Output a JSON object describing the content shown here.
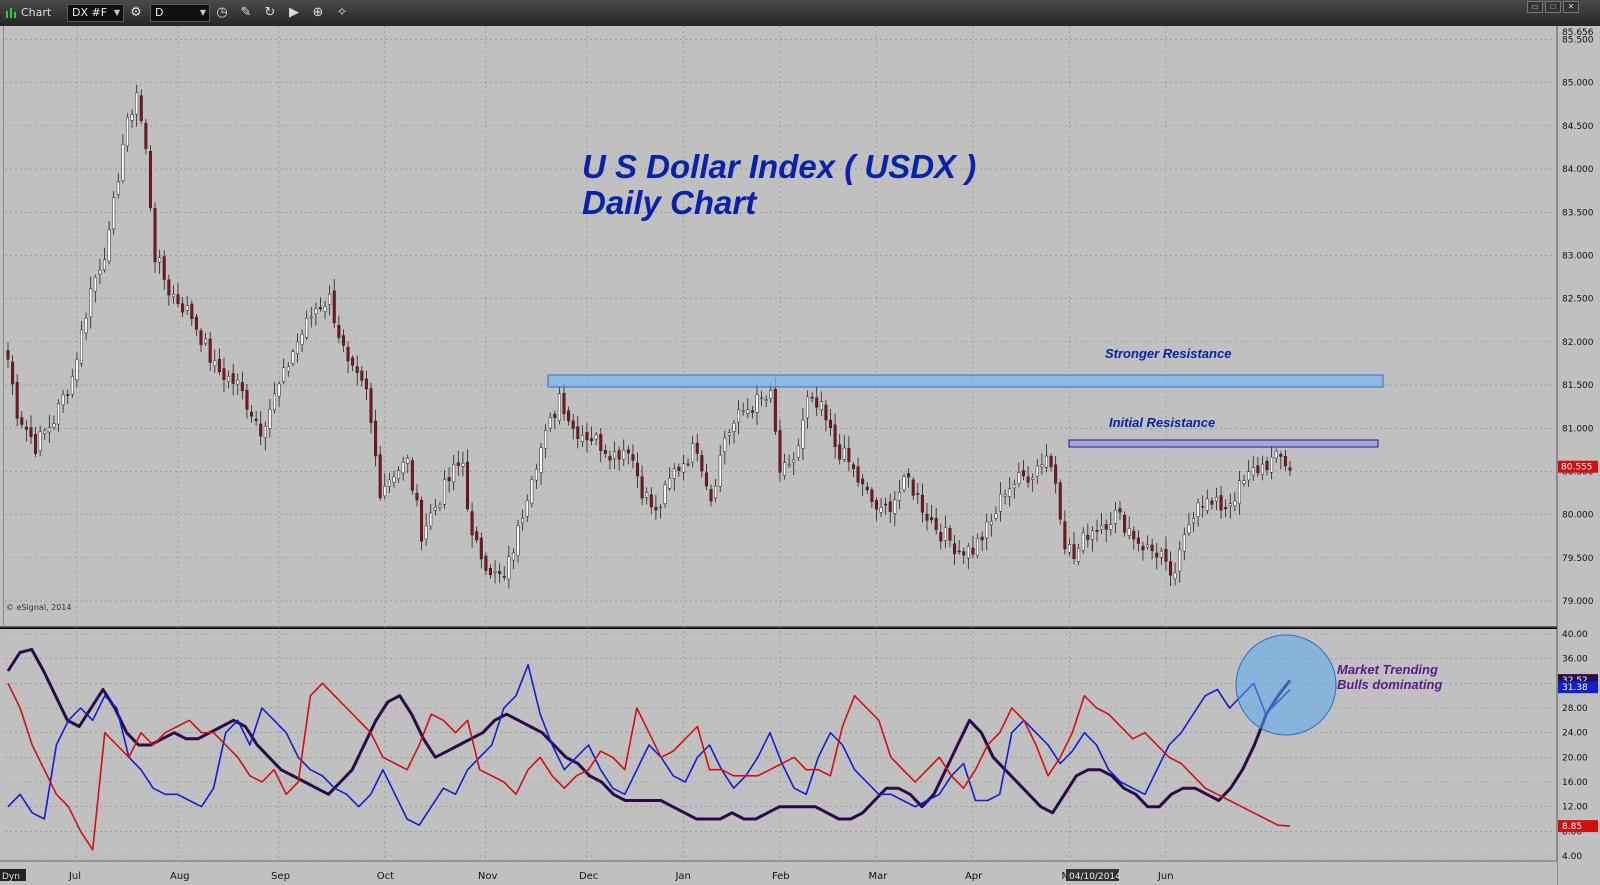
{
  "window": {
    "title": "Chart",
    "symbol": "DX #F",
    "interval": "D",
    "toolbar_icons": [
      "settings-icon",
      "clock-icon",
      "pencil-icon",
      "refresh-icon",
      "play-icon",
      "zoom-icon",
      "wand-icon"
    ]
  },
  "annotations": {
    "title_line1": "U S Dollar Index  ( USDX )",
    "title_line2": "Daily Chart",
    "stronger_resistance": "Stronger Resistance",
    "initial_resistance": "Initial Resistance",
    "trend_line1": "Market Trending",
    "trend_line2": "Bulls dominating",
    "copyright": "© eSignal, 2014",
    "cursor_date": "04/10/2014",
    "dyn_label": "Dyn"
  },
  "colors": {
    "panel_bg": "#c0c0c0",
    "up_candle": "#ffffff",
    "down_candle": "#8b1010",
    "title_blue": "#0a22a8",
    "resistance_fill": "#7eb8ec",
    "adx_line": "#2a0a48",
    "plus_di": "#1020d0",
    "minus_di": "#d01010",
    "callout_purple": "#5a1a8a"
  },
  "chart_data": [
    {
      "type": "candlestick",
      "title": "U S Dollar Index  ( USDX ) Daily Chart",
      "symbol": "DX #F",
      "x_ticks": [
        "Jul",
        "Aug",
        "Sep",
        "Oct",
        "Nov",
        "Dec",
        "Jan",
        "Feb",
        "Mar",
        "Apr",
        "May",
        "Jun"
      ],
      "ylim": [
        78.7,
        85.656
      ],
      "y_ticks": [
        "79.000",
        "79.500",
        "80.000",
        "80.500",
        "81.000",
        "81.500",
        "82.000",
        "82.500",
        "83.000",
        "83.500",
        "84.000",
        "84.500",
        "85.000",
        "85.500"
      ],
      "top_price": "85.656",
      "last_price": "80.555",
      "close_anchors": [
        [
          0,
          81.8
        ],
        [
          2,
          81.2
        ],
        [
          6,
          80.8
        ],
        [
          10,
          81.1
        ],
        [
          14,
          81.6
        ],
        [
          18,
          82.6
        ],
        [
          22,
          83.2
        ],
        [
          25,
          84.3
        ],
        [
          28,
          84.9
        ],
        [
          30,
          84.2
        ],
        [
          32,
          83.0
        ],
        [
          35,
          82.6
        ],
        [
          40,
          82.3
        ],
        [
          45,
          81.7
        ],
        [
          50,
          81.5
        ],
        [
          55,
          81.0
        ],
        [
          60,
          81.6
        ],
        [
          62,
          81.9
        ],
        [
          67,
          82.4
        ],
        [
          70,
          82.5
        ],
        [
          74,
          81.7
        ],
        [
          78,
          81.4
        ],
        [
          81,
          80.3
        ],
        [
          84,
          80.5
        ],
        [
          87,
          80.6
        ],
        [
          90,
          79.8
        ],
        [
          93,
          80.1
        ],
        [
          97,
          80.5
        ],
        [
          99,
          80.6
        ],
        [
          101,
          79.7
        ],
        [
          106,
          79.3
        ],
        [
          108,
          79.25
        ],
        [
          111,
          79.8
        ],
        [
          114,
          80.5
        ],
        [
          117,
          80.9
        ],
        [
          119,
          81.2
        ],
        [
          120,
          81.4
        ],
        [
          123,
          81.0
        ],
        [
          127,
          80.9
        ],
        [
          132,
          80.7
        ],
        [
          135,
          80.8
        ],
        [
          138,
          80.3
        ],
        [
          141,
          80.0
        ],
        [
          145,
          80.5
        ],
        [
          150,
          80.8
        ],
        [
          153,
          80.2
        ],
        [
          156,
          80.9
        ],
        [
          160,
          81.2
        ],
        [
          163,
          81.3
        ],
        [
          166,
          81.35
        ],
        [
          168,
          80.5
        ],
        [
          170,
          80.5
        ],
        [
          172,
          80.8
        ],
        [
          174,
          81.3
        ],
        [
          177,
          81.2
        ],
        [
          180,
          80.8
        ],
        [
          183,
          80.6
        ],
        [
          186,
          80.3
        ],
        [
          190,
          80.0
        ],
        [
          193,
          80.2
        ],
        [
          196,
          80.4
        ],
        [
          198,
          80.2
        ],
        [
          200,
          80.0
        ],
        [
          203,
          79.8
        ],
        [
          207,
          79.6
        ],
        [
          210,
          79.6
        ],
        [
          214,
          79.9
        ],
        [
          217,
          80.3
        ],
        [
          220,
          80.4
        ],
        [
          223,
          80.5
        ],
        [
          226,
          80.7
        ],
        [
          228,
          80.4
        ],
        [
          230,
          79.7
        ],
        [
          232,
          79.5
        ],
        [
          235,
          79.8
        ],
        [
          238,
          79.9
        ],
        [
          241,
          80.0
        ],
        [
          243,
          79.9
        ],
        [
          246,
          79.7
        ],
        [
          248,
          79.6
        ],
        [
          251,
          79.55
        ],
        [
          253,
          79.2
        ],
        [
          255,
          79.5
        ],
        [
          257,
          79.9
        ],
        [
          259,
          80.2
        ],
        [
          262,
          80.1
        ],
        [
          265,
          80.1
        ],
        [
          268,
          80.3
        ],
        [
          271,
          80.5
        ],
        [
          274,
          80.6
        ],
        [
          277,
          80.65
        ],
        [
          279,
          80.55
        ]
      ],
      "annotations": [
        {
          "label": "Stronger Resistance",
          "price_low": 81.45,
          "price_high": 81.58
        },
        {
          "label": "Initial Resistance",
          "price_low": 80.7,
          "price_high": 80.78
        }
      ],
      "grid": true
    },
    {
      "type": "line",
      "name": "ADX / DMI",
      "ylim": [
        4,
        40
      ],
      "y_ticks": [
        "4.00",
        "8.00",
        "12.00",
        "16.00",
        "20.00",
        "24.00",
        "28.00",
        "32.00",
        "36.00",
        "40.00"
      ],
      "last_values": {
        "adx": "32.52",
        "plus_di": "31.38",
        "minus_di": "8.85"
      },
      "series": [
        {
          "key": "adx",
          "values": [
            34,
            37,
            37.5,
            34,
            30,
            26,
            25,
            28,
            31,
            28,
            24,
            22,
            22,
            23,
            24,
            23,
            23,
            24,
            25,
            26,
            25,
            22,
            20,
            18,
            17,
            16,
            15,
            14,
            16,
            18,
            22,
            26,
            29,
            30,
            27,
            23,
            20,
            21,
            22,
            23,
            24,
            26,
            27,
            26,
            25,
            24,
            22,
            20,
            19,
            17,
            16,
            14,
            13,
            13,
            13,
            13,
            12,
            11,
            10,
            10,
            10,
            11,
            10,
            10,
            11,
            12,
            12,
            12,
            12,
            11,
            10,
            10,
            11,
            13,
            15,
            15,
            14,
            12,
            14,
            18,
            22,
            26,
            24,
            20,
            18,
            16,
            14,
            12,
            11,
            14,
            17,
            18,
            18,
            17,
            15,
            14,
            12,
            12,
            14,
            15,
            15,
            14,
            13,
            15,
            18,
            22,
            27,
            30,
            32.5
          ]
        },
        {
          "key": "plus_di",
          "values": [
            12,
            14,
            11,
            10,
            22,
            26,
            28,
            26,
            30,
            28,
            20,
            18,
            15,
            14,
            14,
            13,
            12,
            15,
            24,
            26,
            22,
            28,
            26,
            24,
            20,
            18,
            17,
            15,
            14,
            12,
            14,
            18,
            14,
            10,
            9,
            12,
            15,
            14,
            18,
            20,
            22,
            28,
            30,
            35,
            27,
            22,
            18,
            20,
            22,
            18,
            15,
            14,
            18,
            22,
            20,
            17,
            16,
            20,
            22,
            18,
            15,
            17,
            20,
            24,
            19,
            15,
            14,
            20,
            24,
            22,
            18,
            16,
            14,
            14,
            13,
            12,
            13,
            14,
            17,
            19,
            13,
            13,
            14,
            24,
            26,
            24,
            22,
            19,
            21,
            24,
            22,
            18,
            16,
            15,
            14,
            18,
            22,
            24,
            27,
            30,
            31,
            28,
            30,
            32,
            27,
            29,
            31
          ]
        },
        {
          "key": "minus_di",
          "values": [
            32,
            28,
            22,
            18,
            14,
            12,
            8,
            5,
            24,
            22,
            20,
            24,
            22,
            24,
            25,
            26,
            24,
            24,
            22,
            20,
            17,
            16,
            18,
            14,
            16,
            30,
            32,
            30,
            28,
            26,
            24,
            20,
            19,
            18,
            22,
            27,
            26,
            24,
            26,
            18,
            17,
            16,
            14,
            18,
            20,
            17,
            15,
            17,
            18,
            21,
            20,
            18,
            28,
            24,
            20,
            21,
            23,
            25,
            18,
            18,
            17,
            17,
            17,
            18,
            19,
            20,
            18,
            18,
            17,
            25,
            30,
            28,
            26,
            20,
            18,
            16,
            18,
            20,
            17,
            15,
            18,
            22,
            24,
            28,
            26,
            22,
            17,
            20,
            24,
            30,
            28,
            27,
            25,
            23,
            24,
            22,
            20,
            19,
            17,
            15,
            14,
            13,
            12,
            11,
            10,
            9,
            8.85
          ]
        }
      ],
      "annotations": [
        {
          "label": "Market Trending Bulls dominating"
        }
      ],
      "grid": true
    }
  ]
}
